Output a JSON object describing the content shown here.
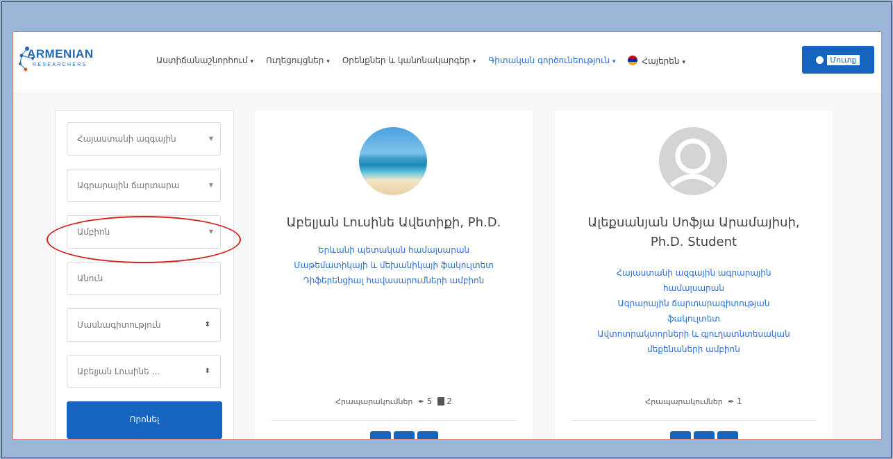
{
  "navbar": {
    "logo_main": "ARMENIAN",
    "logo_sub": "RESEARCHERS",
    "items": [
      {
        "label": "Աստիճանաշնորհում"
      },
      {
        "label": "Ուղեցույցներ"
      },
      {
        "label": "Օրենքներ և կանոնակարգեր"
      },
      {
        "label": "Գիտական գործունեություն"
      },
      {
        "label": "Հայերեն"
      }
    ],
    "login_label": "Մուտք"
  },
  "filters": {
    "university": "Հայաստանի ազգային",
    "faculty": "Ագրարային ճարտարա",
    "chair": "Ամբիոն",
    "name_placeholder": "Անուն",
    "specialty": "Մասնագիտություն",
    "person": "Աբելյան Լուսինե ...",
    "search_button": "Որոնել"
  },
  "cards": [
    {
      "name_line1": "Աբելյան Լուսինե Ավետիքի, Ph.D.",
      "affil1": "Երևանի պետական համալսարան",
      "affil2": "Մաթեմատիկայի և մեխանիկայի ֆակուլտետ",
      "affil3": "Դիֆերենցիալ հավասարումների ամբիոն",
      "pubs_label": "Հրապարակումներ",
      "pubs_count": "5",
      "books_count": "2"
    },
    {
      "name_line1": "Ալեքսանյան Սոֆյա Արամայիսի,",
      "name_line2": "Ph.D. Student",
      "affil1": "Հայաստանի ազգային ագրարային",
      "affil2": "համալսարան",
      "affil3": "Ագրարային ճարտարագիտության",
      "affil4": "ֆակուլտետ",
      "affil5": "Ավտոտրակտորների և գյուղատնտեսական",
      "affil6": "մեքենաների ամբիոն",
      "pubs_label": "Հրապարակումներ",
      "pubs_count": "1"
    }
  ]
}
